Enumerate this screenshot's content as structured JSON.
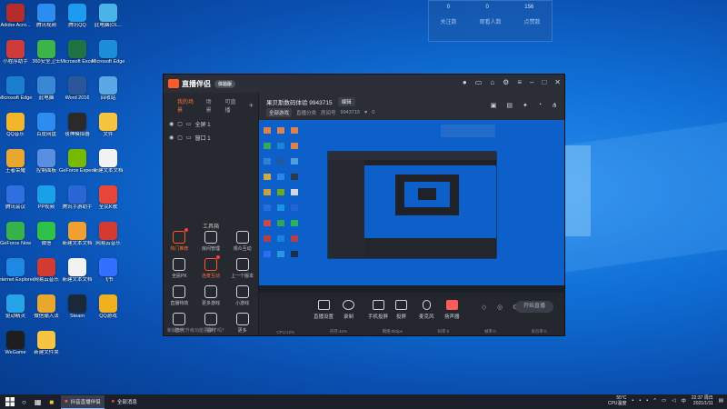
{
  "desktop": {
    "icons": [
      {
        "label": "Adobe Acro...",
        "color": "#b32d2d"
      },
      {
        "label": "腾讯视频",
        "color": "#2c8cf0"
      },
      {
        "label": "腾讯QQ",
        "color": "#1d9bf0"
      },
      {
        "label": "此电脑(OL...",
        "color": "#4ab4e6"
      },
      {
        "label": "小程序助手",
        "color": "#d03a3a"
      },
      {
        "label": "360安全卫士",
        "color": "#3bb54a"
      },
      {
        "label": "Microsoft Excel",
        "color": "#1f7244"
      },
      {
        "label": "Microsoft Edge",
        "color": "#1c8dd8"
      },
      {
        "label": "Microsoft Edge",
        "color": "#1a7fd0"
      },
      {
        "label": "此电脑",
        "color": "#3a87d6"
      },
      {
        "label": "Word 2016",
        "color": "#2b579a"
      },
      {
        "label": "回收站",
        "color": "#5aa9e6"
      },
      {
        "label": "QQ音乐",
        "color": "#f2b62d"
      },
      {
        "label": "百度网盘",
        "color": "#2d8cf0"
      },
      {
        "label": "夜神模拟器",
        "color": "#2a2a2a"
      },
      {
        "label": "文件",
        "color": "#f5c542"
      },
      {
        "label": "王者荣耀",
        "color": "#e8a830"
      },
      {
        "label": "控制面板",
        "color": "#5a8ee0"
      },
      {
        "label": "GeForce Experience",
        "color": "#76b900"
      },
      {
        "label": "新建文本文档",
        "color": "#f2f2f2"
      },
      {
        "label": "腾讯会议",
        "color": "#2f6fe0"
      },
      {
        "label": "PP视频",
        "color": "#1aa0e8"
      },
      {
        "label": "腾讯手游助手",
        "color": "#2a66d6"
      },
      {
        "label": "全民K歌",
        "color": "#e8463a"
      },
      {
        "label": "GeForce Now",
        "color": "#38b24a"
      },
      {
        "label": "微信",
        "color": "#2ec24a"
      },
      {
        "label": "新建文本文档",
        "color": "#f0a030"
      },
      {
        "label": "网易云音乐",
        "color": "#d33a31"
      },
      {
        "label": "Internet Explorer",
        "color": "#1e88e5"
      },
      {
        "label": "网易云音乐",
        "color": "#d33a31"
      },
      {
        "label": "新建文本文档",
        "color": "#f2f2f2"
      },
      {
        "label": "飞书",
        "color": "#3370ff"
      },
      {
        "label": "驱动精灵",
        "color": "#29a3e8"
      },
      {
        "label": "微信输入法",
        "color": "#e8a830"
      },
      {
        "label": "Steam",
        "color": "#1b2838"
      },
      {
        "label": "QQ游戏",
        "color": "#f0b020"
      },
      {
        "label": "WeGame",
        "color": "#1e1e1e"
      },
      {
        "label": "新建文件夹",
        "color": "#f5c542"
      }
    ]
  },
  "notification": {
    "counts": [
      "0",
      "0",
      "156"
    ],
    "labels": [
      "关注数",
      "观看人数",
      "点赞数"
    ]
  },
  "app": {
    "title": "直播伴侣",
    "version": "体验版",
    "tabs": [
      "我的场景",
      "场景",
      "可直播",
      "+"
    ],
    "sources": [
      "全屏 1",
      "窗口 1"
    ],
    "tools_title": "工具箱",
    "tools": [
      {
        "label": "热门推荐",
        "hot": true
      },
      {
        "label": "房间管理",
        "hot": false
      },
      {
        "label": "观众互动",
        "hot": false
      },
      {
        "label": "全民PK",
        "hot": false
      },
      {
        "label": "连麦互动",
        "hot": true
      },
      {
        "label": "上一个版本",
        "hot": false
      },
      {
        "label": "直播特效",
        "hot": false
      },
      {
        "label": "更多游戏",
        "hot": false
      },
      {
        "label": "小游戏",
        "hot": false
      },
      {
        "label": "音乐",
        "hot": false
      },
      {
        "label": "福利",
        "hot": false
      },
      {
        "label": "更多",
        "hot": false
      }
    ],
    "footer": "新版本可升级功能更多了吗？",
    "room_title": "果贝斯数码体验 9943715",
    "edit_label": "编辑",
    "category_label": "全部游戏",
    "category_value": "直播分类",
    "room_id_label": "房间号",
    "room_id": "9943715",
    "fans": "0",
    "controls": [
      "直播设置",
      "录制",
      "手机投屏",
      "投屏",
      "麦克风",
      "扬声器"
    ],
    "start_label": "开始直播",
    "status": [
      "CPU:12%",
      "内存:42%",
      "网络:0kbps",
      "码率:0",
      "帧率:0",
      "丢包率:0"
    ]
  },
  "taskbar": {
    "apps": [
      "抖音直播伴侣",
      "全部消息"
    ],
    "temp": "55°C",
    "temp_label": "CPU温度",
    "lang": "中",
    "time": "22:37 周日",
    "date": "2021/1/11"
  }
}
